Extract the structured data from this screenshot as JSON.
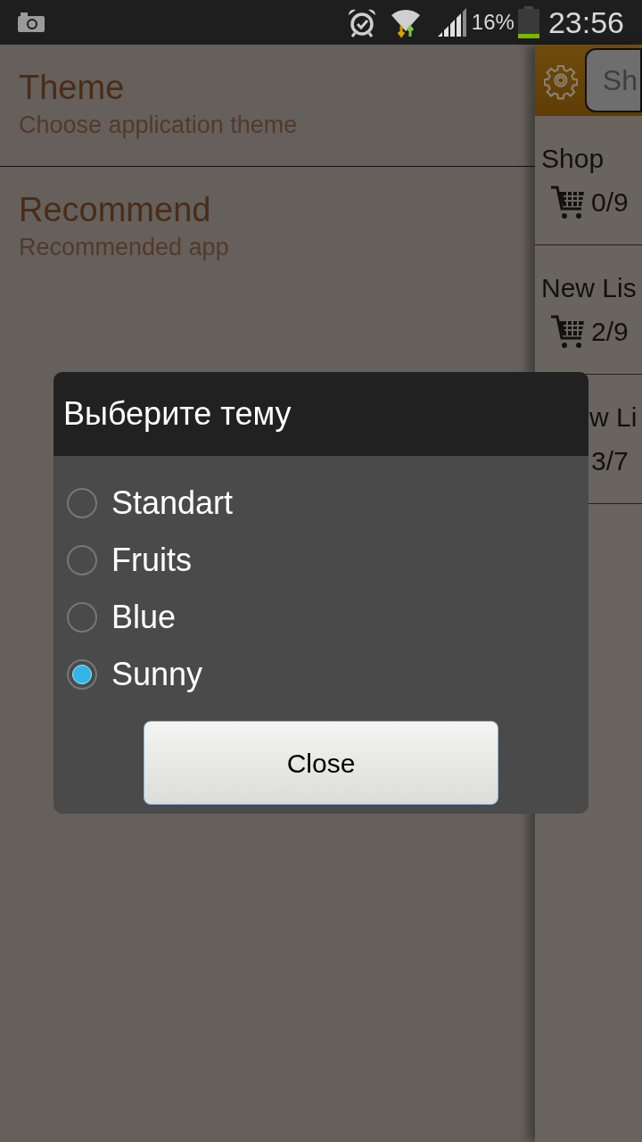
{
  "status_bar": {
    "battery_percent": "16%",
    "time": "23:56"
  },
  "settings": [
    {
      "title": "Theme",
      "subtitle": "Choose application theme"
    },
    {
      "title": "Recommend",
      "subtitle": "Recommended app"
    }
  ],
  "side_panel": {
    "search_placeholder": "Sh",
    "lists": [
      {
        "name": "Shop",
        "count": "0/9",
        "cart_icon": true,
        "name_cut_start": false
      },
      {
        "name": "New Lis",
        "count": "2/9",
        "cart_icon": true,
        "name_cut_start": false
      },
      {
        "name": "w Li",
        "count": "3/7",
        "cart_icon": false,
        "name_cut_start": true
      }
    ]
  },
  "dialog": {
    "title": "Выберите тему",
    "options": [
      {
        "label": "Standart",
        "selected": false
      },
      {
        "label": "Fruits",
        "selected": false
      },
      {
        "label": "Blue",
        "selected": false
      },
      {
        "label": "Sunny",
        "selected": true
      }
    ],
    "button": "Close"
  }
}
